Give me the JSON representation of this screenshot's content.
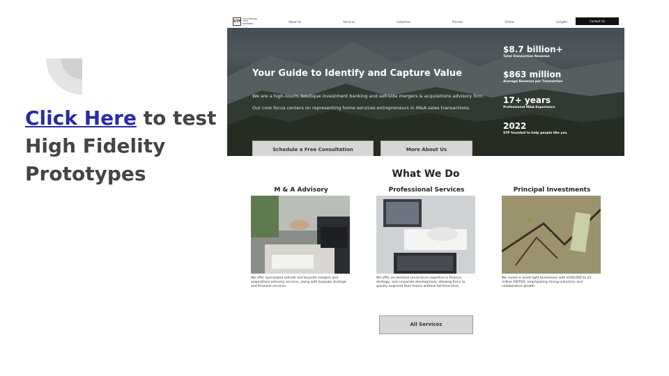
{
  "slide": {
    "link_text": "Click Here",
    "heading_rest": " to test High Fidelity Prototypes"
  },
  "site": {
    "logo_text": "STP STERLING TRUE PARTNERS",
    "nav": [
      "About Us",
      "Services",
      "Industries",
      "Process",
      "Clients",
      "Insights"
    ],
    "contact_label": "Contact Us",
    "hero": {
      "title": "Your Guide to Identify and Capture Value",
      "p1": "We are a high-touch, boutique investment banking and sell-side mergers & acquisitions advisory firm.",
      "p2": "Our core focus centers on representing home services entrepreneurs in M&A sales transactions.",
      "btn_consult": "Schedule a Free Consultation",
      "btn_more": "More About Us",
      "stats": [
        {
          "value": "$8.7 billion+",
          "label": "Total Transaction Revenue"
        },
        {
          "value": "$863 million",
          "label": "Average Revenue per Transaction"
        },
        {
          "value": "17+ years",
          "label": "Professional M&A Experience"
        },
        {
          "value": "2022",
          "label": "STP founded to help people like you"
        }
      ]
    },
    "what_we_do": {
      "title": "What We Do",
      "cards": [
        {
          "title": "M & A Advisory",
          "desc": "We offer specialized sellside and buyside mergers and acquisitions advisory services, along with bespoke strategic and financial services."
        },
        {
          "title": "Professional Services",
          "desc": "We offer on-demand senior-level expertise in finance, strategy, and corporate development, allowing firms to quickly augment their teams without full-time hires."
        },
        {
          "title": "Principal Investments",
          "desc": "We invest in asset-light businesses with $500,000 to $3 million EBITDA, emphasizing strong industries and collaborative growth."
        }
      ],
      "all_services_label": "All Services"
    }
  },
  "colors": {
    "link": "#2a2aa8",
    "heading": "#444444",
    "contact_bg": "#111111",
    "button_bg": "#d6d6d6"
  }
}
